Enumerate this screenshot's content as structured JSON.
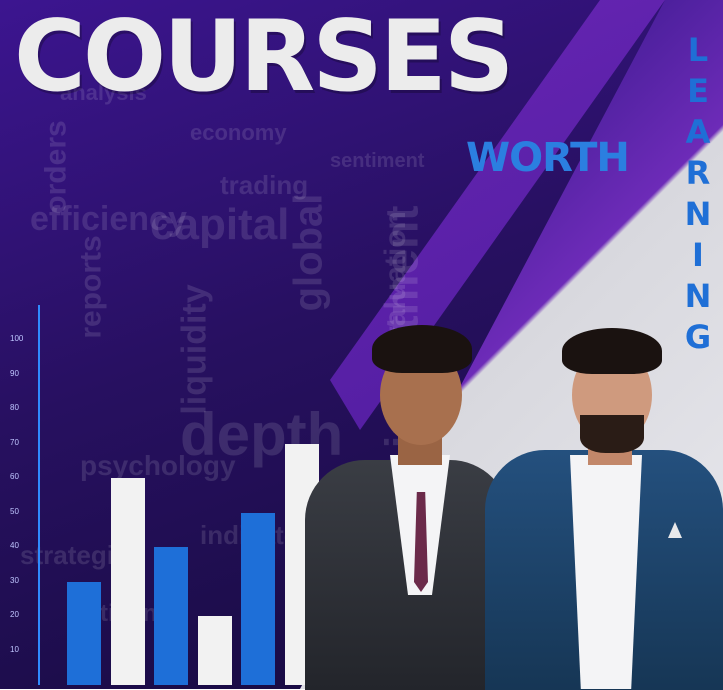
{
  "title": {
    "main": "COURSES",
    "sub": "WORTH",
    "vertical_letters": [
      "L",
      "E",
      "A",
      "R",
      "N",
      "I",
      "N",
      "G"
    ]
  },
  "background_words": [
    "orders",
    "trading",
    "capital",
    "analysis",
    "global",
    "economy",
    "sentiment",
    "reports",
    "liquidity",
    "psychology",
    "investment",
    "strategies",
    "depth",
    "timing",
    "valuation",
    "efficiency",
    "indicators"
  ],
  "chart": {
    "ticks": [
      "100",
      "90",
      "80",
      "70",
      "60",
      "50",
      "40",
      "30",
      "20",
      "10"
    ],
    "bars": [
      {
        "value": 30,
        "color": "blue"
      },
      {
        "value": 60,
        "color": "white"
      },
      {
        "value": 40,
        "color": "blue"
      },
      {
        "value": 20,
        "color": "white"
      },
      {
        "value": 50,
        "color": "blue"
      },
      {
        "value": 70,
        "color": "white"
      }
    ]
  },
  "colors": {
    "accent_blue": "#1e6fd8",
    "title_white": "#ececec",
    "purple": "#4a1aa8"
  }
}
